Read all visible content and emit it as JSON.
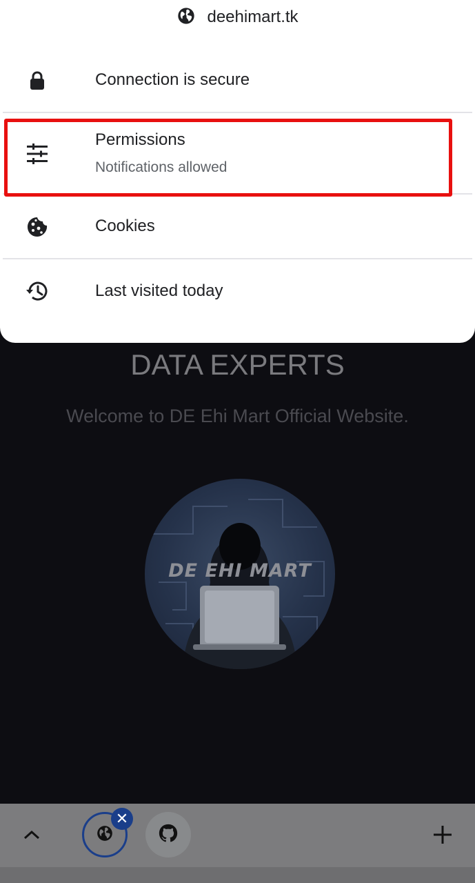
{
  "site": {
    "title": "DATA EXPERTS",
    "welcome": "Welcome to DE Ehi Mart Official Website.",
    "logo_text": "DE EHI MART"
  },
  "sheet": {
    "domain": "deehimart.tk",
    "domain_icon": "globe-icon",
    "rows": [
      {
        "icon": "lock-icon",
        "label": "Connection is secure"
      },
      {
        "icon": "tune-icon",
        "label": "Permissions",
        "sublabel": "Notifications allowed"
      },
      {
        "icon": "cookie-icon",
        "label": "Cookies"
      },
      {
        "icon": "history-icon",
        "label": "Last visited today"
      }
    ]
  },
  "bottombar": {
    "tabs": [
      {
        "icon": "globe-icon",
        "active": true
      },
      {
        "icon": "github-icon",
        "active": false
      }
    ],
    "close_glyph": "✕",
    "expand_icon": "chevron-up-icon",
    "new_tab_icon": "plus-icon"
  },
  "colors": {
    "highlight": "#e8100f",
    "active_tab": "#1a3e8a"
  }
}
